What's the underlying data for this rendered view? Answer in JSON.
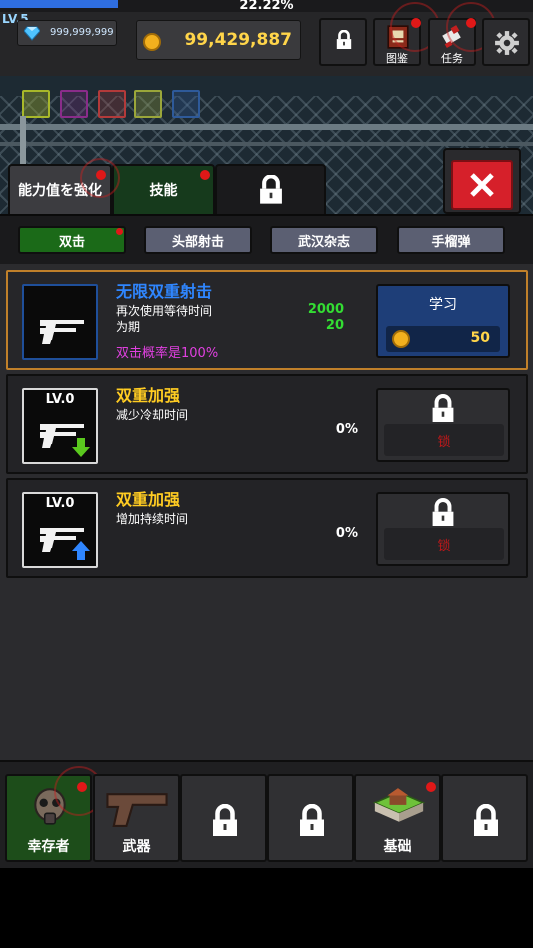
{
  "header": {
    "xp_percent": "22.22%",
    "xp_fraction": 0.2222,
    "level": "LV.5",
    "gems": "999,999,999",
    "coins": "99,429,887",
    "buttons": {
      "codex_label": "图鉴",
      "mission_label": "任务"
    }
  },
  "tabs": {
    "ability": "能力值を強化",
    "skill": "技能"
  },
  "subtabs": [
    "双击",
    "头部射击",
    "武汉杂志",
    "手榴弹"
  ],
  "skills": [
    {
      "name": "无限双重射击",
      "desc1": "再次使用等待时间",
      "desc2": "为期",
      "val1": "2000",
      "val2": "20",
      "extra": "双击概率是100%",
      "button": "学习",
      "cost": "50"
    },
    {
      "lv": "LV.0",
      "name": "双重加强",
      "desc": "减少冷却时间",
      "value": "0%",
      "lock_label": "锁"
    },
    {
      "lv": "LV.0",
      "name": "双重加强",
      "desc": "增加持续时间",
      "value": "0%",
      "lock_label": "锁"
    }
  ],
  "bottom_nav": {
    "survivor": "幸存者",
    "weapon": "武器",
    "base": "基础"
  },
  "colors": {
    "accent_blue": "#2f6ee0",
    "gold": "#ffd54a",
    "skill_title_selected": "#2f86ff",
    "skill_title": "#ffcc22",
    "magenta": "#e040e0",
    "green_value": "#33dd33"
  }
}
